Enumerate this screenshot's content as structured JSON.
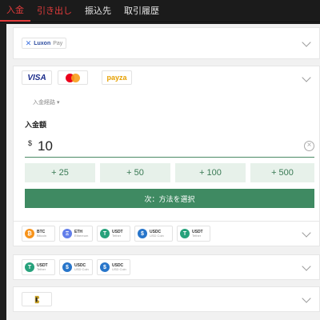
{
  "tabs": [
    {
      "label": "入金"
    },
    {
      "label": "引き出し"
    },
    {
      "label": "振込先"
    },
    {
      "label": "取引履歴"
    }
  ],
  "luxon": {
    "brand": "Luxon",
    "suffix": "Pay"
  },
  "cards_row": {
    "visa": "VISA",
    "payz_main": "payz",
    "payz_accent": "a"
  },
  "method_select": {
    "label": "入金経路"
  },
  "amount": {
    "label": "入金額",
    "currency": "$",
    "value": "10"
  },
  "quick_amounts": [
    "+ 25",
    "+ 50",
    "+ 100",
    "+ 500"
  ],
  "submit_label": "次：方法を選択",
  "crypto_row1": [
    {
      "symbol": "BTC",
      "network": "Bitcoin",
      "icon": "₿",
      "color": "#f7931a"
    },
    {
      "symbol": "ETH",
      "network": "Ethereum",
      "icon": "Ξ",
      "color": "#627eea"
    },
    {
      "symbol": "USDT",
      "network": "Tether",
      "icon": "T",
      "color": "#26a17b"
    },
    {
      "symbol": "USDC",
      "network": "USD Coin",
      "icon": "$",
      "color": "#2775ca"
    },
    {
      "symbol": "USDT",
      "network": "Tether",
      "icon": "T",
      "color": "#26a17b"
    }
  ],
  "crypto_row2": [
    {
      "symbol": "USDT",
      "network": "Tether",
      "icon": "T",
      "color": "#26a17b"
    },
    {
      "symbol": "USDC",
      "network": "USD Coin",
      "icon": "$",
      "color": "#2775ca"
    },
    {
      "symbol": "USDC",
      "network": "USD Coin",
      "icon": "$",
      "color": "#2775ca"
    }
  ],
  "colors": {
    "active_tab": "#e23b3b",
    "submit_bg": "#3f8a62",
    "quick_bg": "#e7f1ea"
  }
}
